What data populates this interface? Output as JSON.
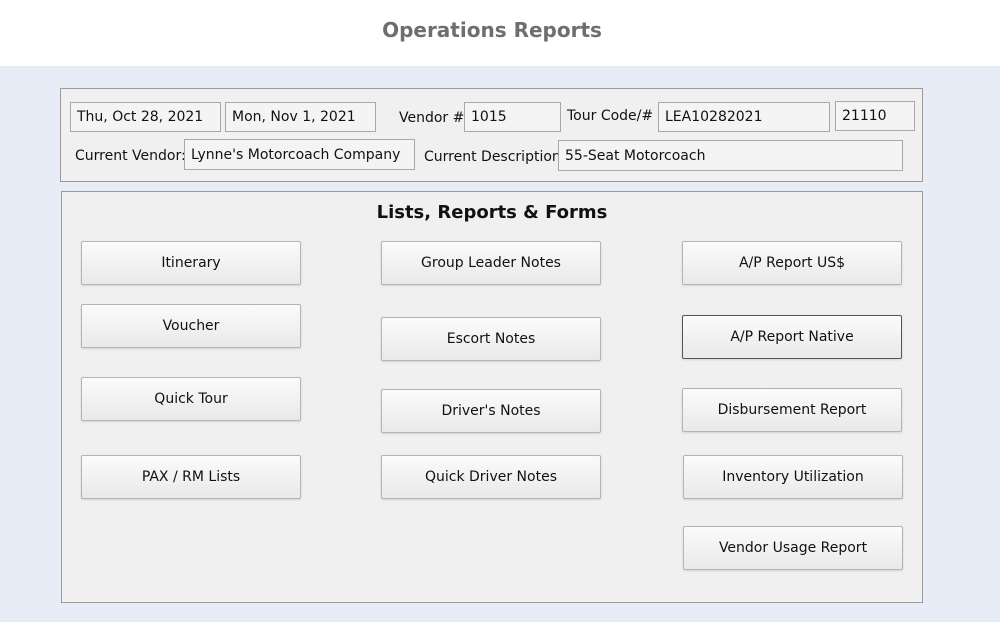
{
  "header": {
    "title": "Operations Reports"
  },
  "info": {
    "start_date": "Thu, Oct 28, 2021",
    "end_date": "Mon, Nov 1, 2021",
    "vendor_label": "Vendor #",
    "vendor_value": "1015",
    "tour_code_label": "Tour Code/#",
    "tour_code_value": "LEA10282021",
    "tour_number_value": "21110",
    "current_vendor_label": "Current Vendor:",
    "current_vendor_value": "Lynne's Motorcoach Company",
    "current_description_label": "Current Description:",
    "current_description_value": "55-Seat Motorcoach"
  },
  "reports": {
    "title": "Lists, Reports & Forms",
    "buttons": {
      "itinerary": "Itinerary",
      "voucher": "Voucher",
      "quick_tour": "Quick Tour",
      "pax_rm_lists": "PAX / RM Lists",
      "group_leader_notes": "Group Leader Notes",
      "escort_notes": "Escort Notes",
      "drivers_notes": "Driver's Notes",
      "quick_driver_notes": "Quick Driver Notes",
      "ap_report_us": "A/P Report US$",
      "ap_report_native": "A/P Report Native",
      "disbursement_report": "Disbursement Report",
      "inventory_utilization": "Inventory Utilization",
      "vendor_usage_report": "Vendor Usage Report"
    }
  }
}
